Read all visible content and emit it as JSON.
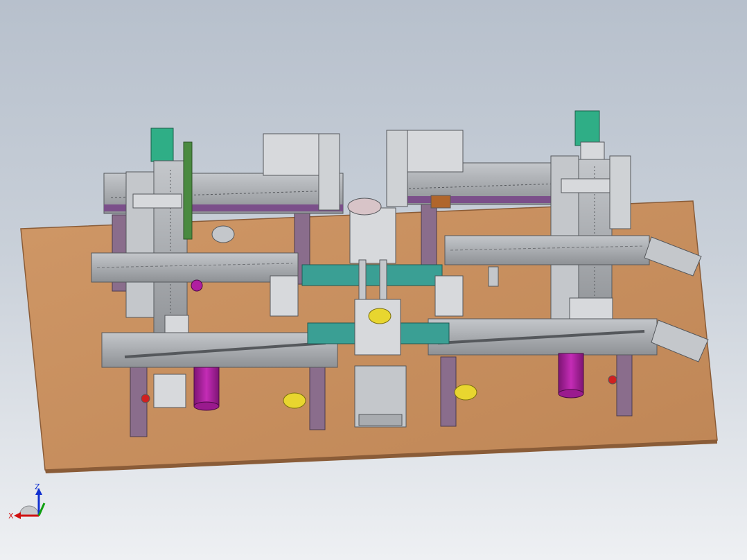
{
  "triad": {
    "x_label": "X",
    "z_label": "Z"
  },
  "colors": {
    "background_top": "#b7c0cc",
    "background_bottom": "#eef0f3",
    "base_plate": "#c98f5e",
    "base_edge": "#8a5c38",
    "rail_gray": "#a9acb0",
    "rail_dark": "#6f7276",
    "motor_green": "#2fae86",
    "teal_plate": "#3a9f94",
    "magenta_motor": "#b01fa0",
    "yellow_wheel": "#e8d62f",
    "post_purple": "#8a6d8c",
    "axis_x": "#d01010",
    "axis_y": "#10a010",
    "axis_z": "#1030d0"
  }
}
